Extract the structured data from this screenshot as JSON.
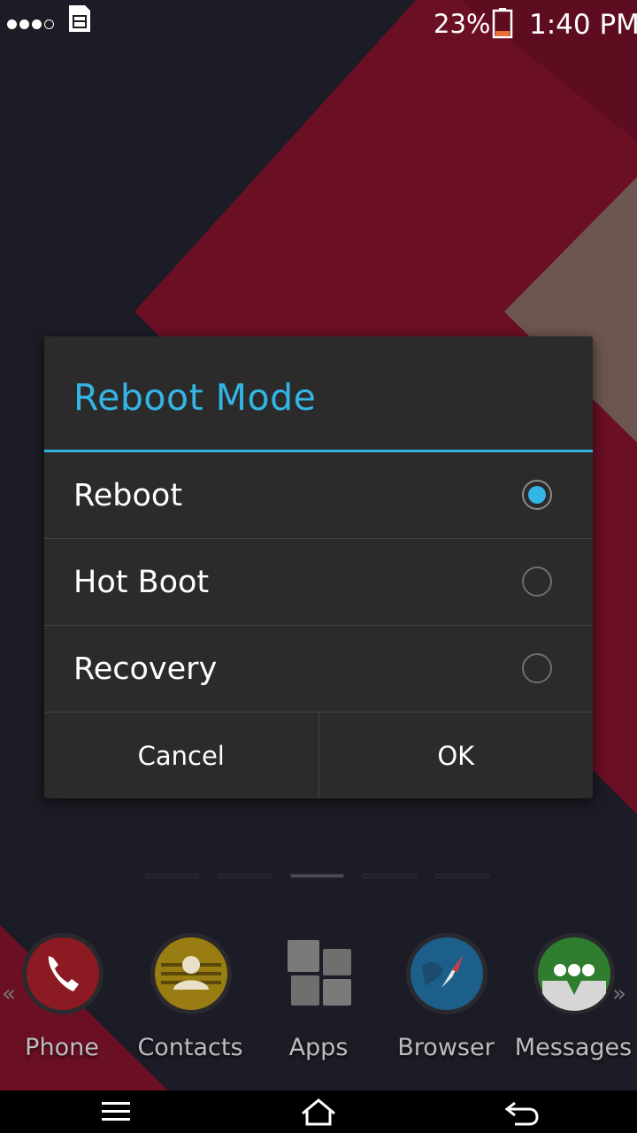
{
  "status_bar": {
    "battery_percent": "23%",
    "battery_level": 0.23,
    "time": "1:40 PM",
    "signal_dots_filled": 3,
    "signal_dots_total": 4
  },
  "dialog": {
    "title": "Reboot Mode",
    "options": [
      {
        "label": "Reboot",
        "checked": true
      },
      {
        "label": "Hot Boot",
        "checked": false
      },
      {
        "label": "Recovery",
        "checked": false
      }
    ],
    "cancel_label": "Cancel",
    "ok_label": "OK"
  },
  "home": {
    "page_count": 5,
    "active_page": 2,
    "dock": [
      {
        "label": "Phone",
        "icon": "phone-icon"
      },
      {
        "label": "Contacts",
        "icon": "contacts-icon"
      },
      {
        "label": "Apps",
        "icon": "apps-grid-icon"
      },
      {
        "label": "Browser",
        "icon": "browser-compass-icon"
      },
      {
        "label": "Messages",
        "icon": "messages-icon"
      }
    ],
    "dock_prev_arrow": "«",
    "dock_next_arrow": "»"
  },
  "nav_bar": {
    "icons": [
      "menu-icon",
      "home-icon",
      "back-icon"
    ]
  },
  "colors": {
    "accent": "#33b5e5",
    "wallpaper_red": "#6b0f25",
    "wallpaper_dark": "#1a1b24"
  }
}
